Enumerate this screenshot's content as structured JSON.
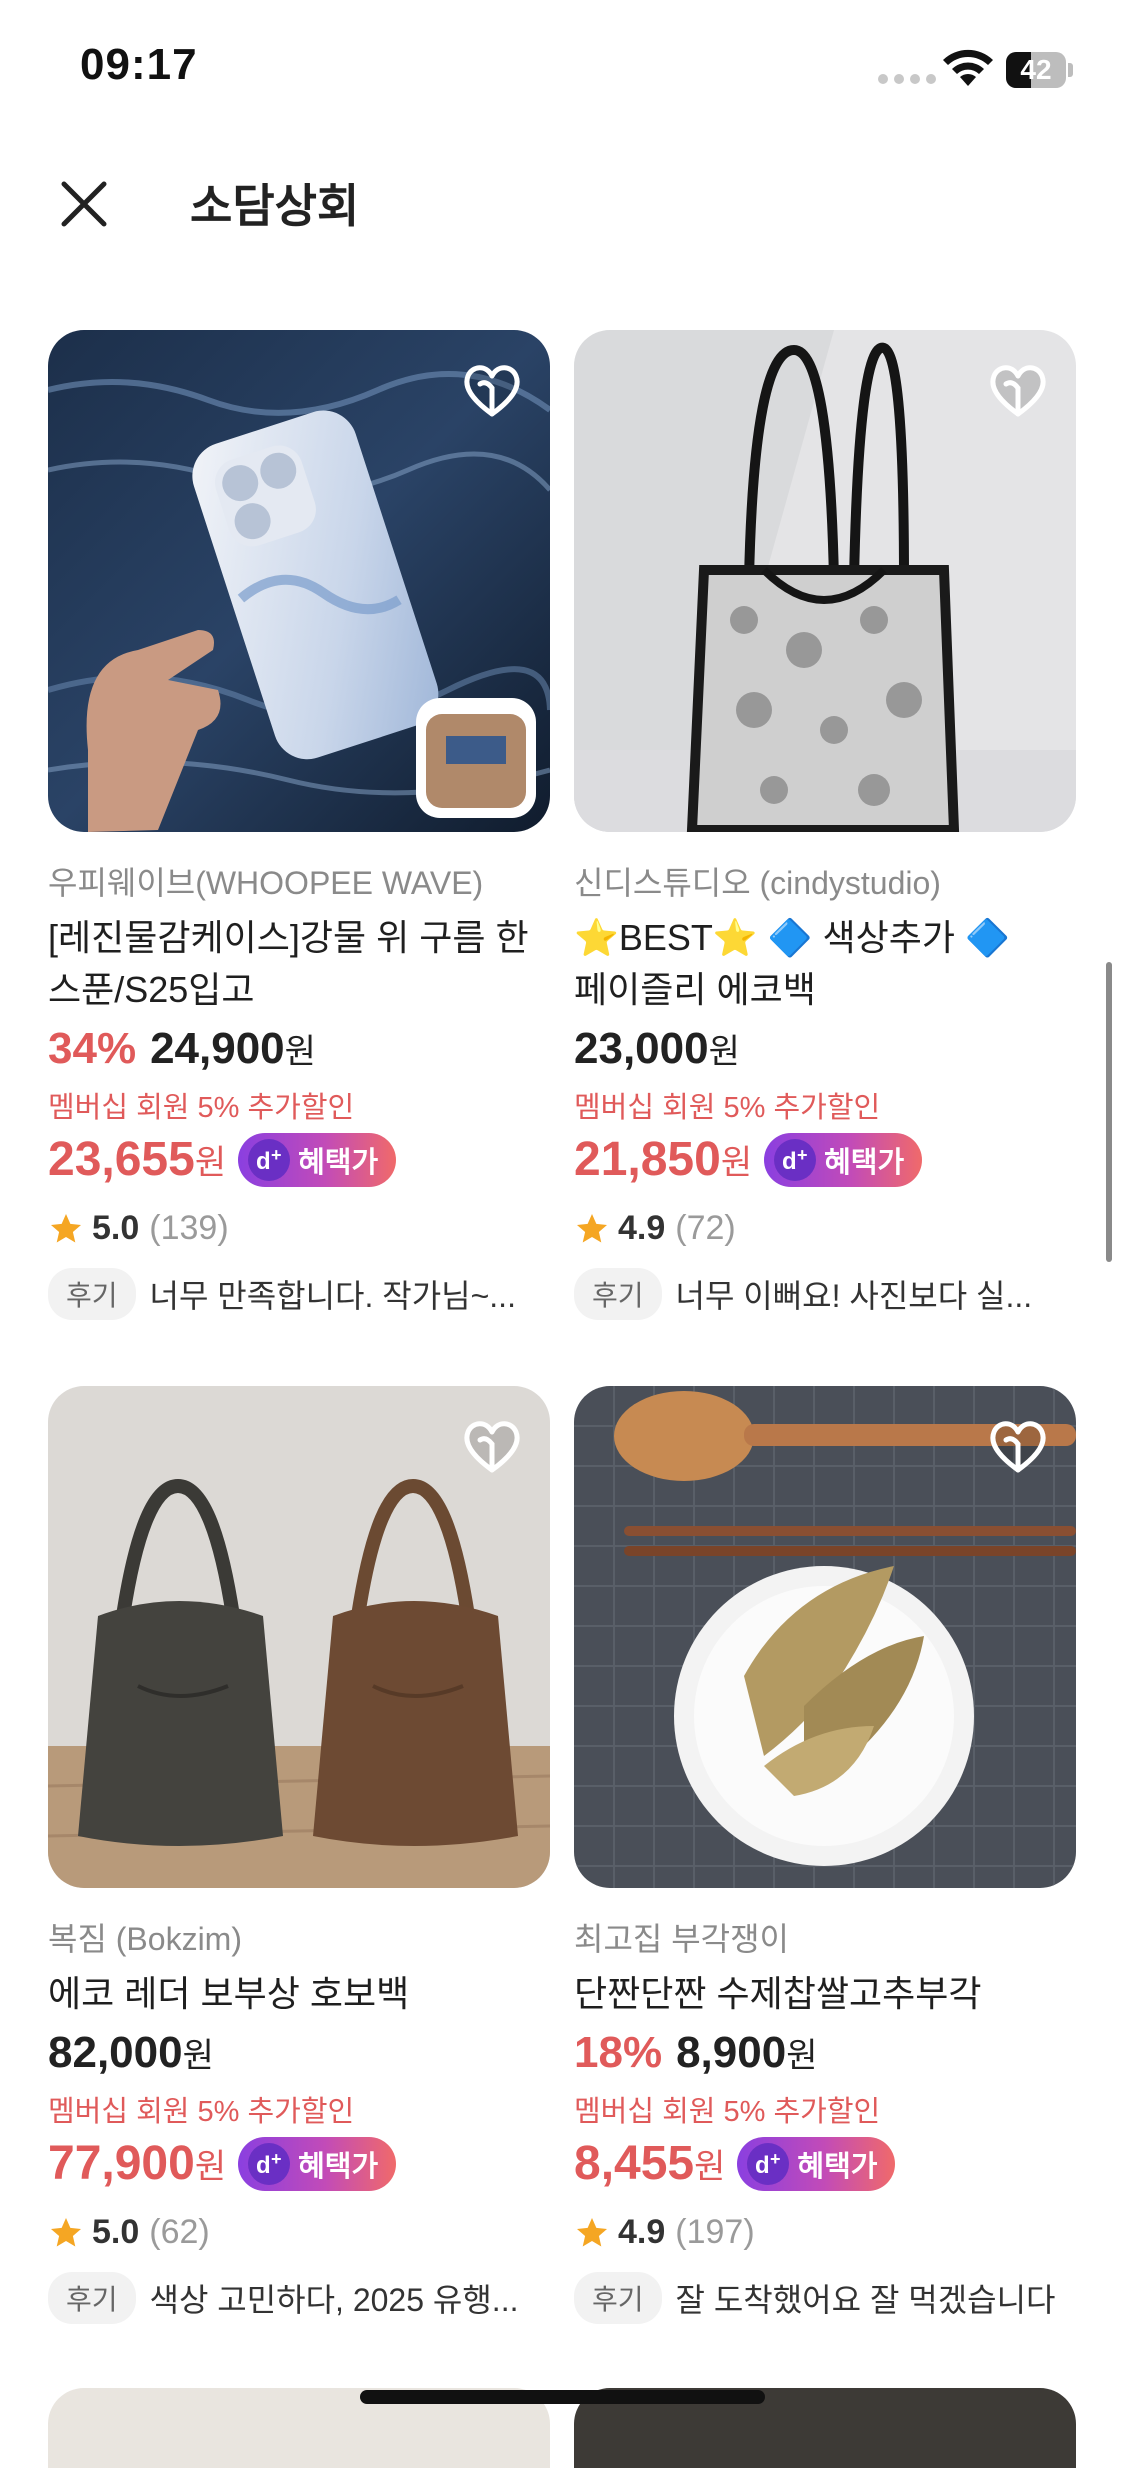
{
  "status_bar": {
    "time": "09:17",
    "battery": "42",
    "battery_level": 0.42
  },
  "header": {
    "title": "소담상회",
    "close_icon": "close-icon"
  },
  "products": [
    {
      "shop": "우피웨이브(WHOOPEE WAVE)",
      "name": "[레진물감케이스]강물 위 구름 한 스푼/S25입고",
      "discount": "34%",
      "price": "24,900",
      "won": "원",
      "member_note": "멤버십 회원 5% 추가할인",
      "final_price": "23,655",
      "badge": "혜택가",
      "rating": "5.0",
      "review_count": "(139)",
      "review_tag": "후기",
      "review_text": "너무 만족합니다. 작가님~..."
    },
    {
      "shop": "신디스튜디오 (cindystudio)",
      "name": "⭐BEST⭐ 🔷 색상추가 🔷 페이즐리 에코백",
      "discount": "",
      "price": "23,000",
      "won": "원",
      "member_note": "멤버십 회원 5% 추가할인",
      "final_price": "21,850",
      "badge": "혜택가",
      "rating": "4.9",
      "review_count": "(72)",
      "review_tag": "후기",
      "review_text": "너무 이뻐요! 사진보다 실..."
    },
    {
      "shop": "복짐 (Bokzim)",
      "name": "에코 레더 보부상 호보백",
      "discount": "",
      "price": "82,000",
      "won": "원",
      "member_note": "멤버십 회원 5% 추가할인",
      "final_price": "77,900",
      "badge": "혜택가",
      "rating": "5.0",
      "review_count": "(62)",
      "review_tag": "후기",
      "review_text": "색상 고민하다, 2025 유행..."
    },
    {
      "shop": "최고집 부각쟁이",
      "name": "단짠단짠 수제찹쌀고추부각",
      "discount": "18%",
      "price": "8,900",
      "won": "원",
      "member_note": "멤버십 회원 5% 추가할인",
      "final_price": "8,455",
      "badge": "혜택가",
      "rating": "4.9",
      "review_count": "(197)",
      "review_tag": "후기",
      "review_text": "잘 도착했어요 잘 먹겠습니다"
    }
  ],
  "colors": {
    "accent_red": "#e05a5a",
    "badge_start": "#8a3fe0",
    "badge_end": "#f06a6a",
    "star": "#f5a623"
  }
}
